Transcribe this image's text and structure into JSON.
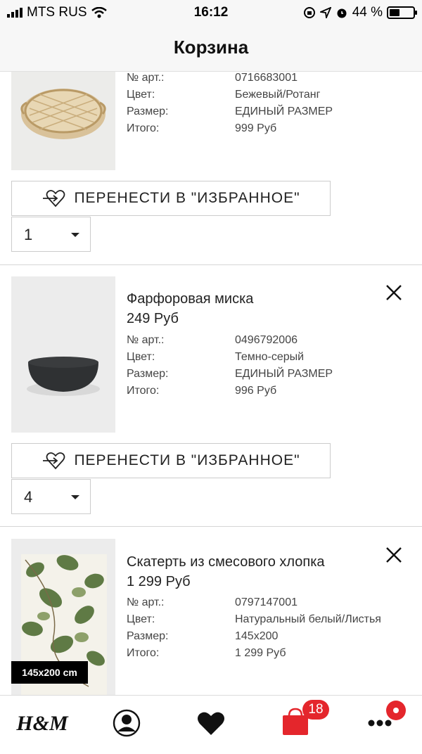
{
  "status_bar": {
    "carrier": "MTS RUS",
    "time": "16:12",
    "battery": "44 %",
    "battery_level": 0.44
  },
  "header": {
    "title": "Корзина"
  },
  "items": [
    {
      "name": "",
      "price": "",
      "details": [
        {
          "label": "№ арт.:",
          "value": "0716683001"
        },
        {
          "label": "Цвет:",
          "value": "Бежевый/Ротанг"
        },
        {
          "label": "Размер:",
          "value": "ЕДИНЫЙ РАЗМЕР"
        },
        {
          "label": "Итого:",
          "value": "999 Руб"
        }
      ],
      "favorite_label": "ПЕРЕНЕСТИ В \"ИЗБРАННОЕ\"",
      "quantity": "1"
    },
    {
      "name": "Фарфоровая миска",
      "price": "249 Руб",
      "details": [
        {
          "label": "№ арт.:",
          "value": "0496792006"
        },
        {
          "label": "Цвет:",
          "value": "Темно-серый"
        },
        {
          "label": "Размер:",
          "value": "ЕДИНЫЙ РАЗМЕР"
        },
        {
          "label": "Итого:",
          "value": "996 Руб"
        }
      ],
      "favorite_label": "ПЕРЕНЕСТИ В \"ИЗБРАННОЕ\"",
      "quantity": "4"
    },
    {
      "name": "Скатерть из смесового хлопка",
      "price": "1 299 Руб",
      "details": [
        {
          "label": "№ арт.:",
          "value": "0797147001"
        },
        {
          "label": "Цвет:",
          "value": "Натуральный белый/Листья"
        },
        {
          "label": "Размер:",
          "value": "145x200"
        },
        {
          "label": "Итого:",
          "value": "1 299 Руб"
        }
      ],
      "size_tag": "145x200 cm"
    }
  ],
  "tabbar": {
    "logo": "H&M",
    "cart_badge": "18",
    "accent": "#e4262c",
    "icons": [
      "hm-logo-icon",
      "profile-icon",
      "heart-icon",
      "shopping-bag-icon",
      "more-icon"
    ]
  }
}
